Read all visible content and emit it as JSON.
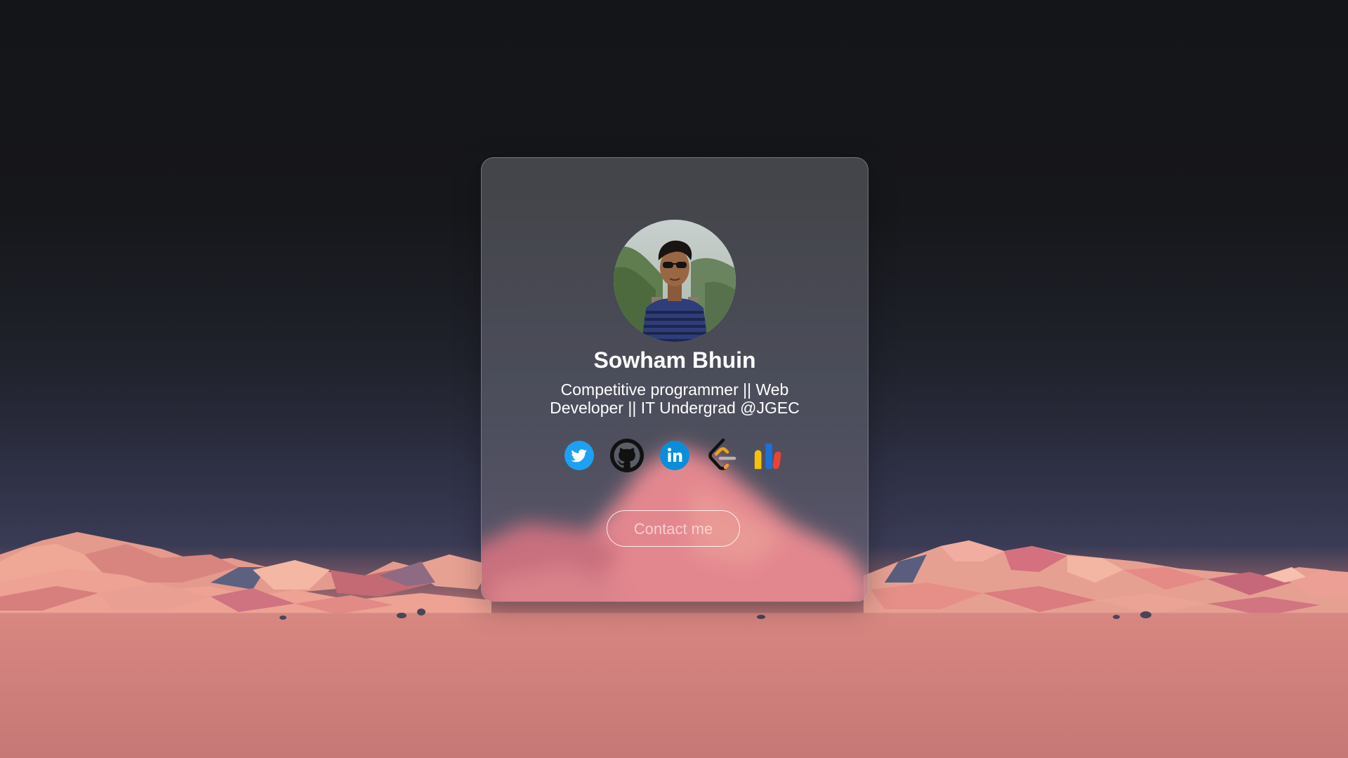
{
  "profile": {
    "name": "Sowham Bhuin",
    "bio": "Competitive programmer || Web Developer || IT Undergrad @JGEC",
    "avatar_alt": "profile photo"
  },
  "socials": [
    {
      "name": "twitter",
      "icon": "twitter-icon",
      "color": "#1da1f2"
    },
    {
      "name": "github",
      "icon": "github-icon",
      "color": "#111111"
    },
    {
      "name": "linkedin",
      "icon": "linkedin-icon",
      "color": "#0a8ed9"
    },
    {
      "name": "leetcode",
      "icon": "leetcode-icon",
      "color": "#f0a020"
    },
    {
      "name": "google-analytics",
      "icon": "bar-chart-icon",
      "color": "#1e6fd6"
    }
  ],
  "contact": {
    "label": "Contact me"
  },
  "colors": {
    "sky_top": "#141518",
    "mountain": "#e8908a",
    "ground": "#c57876",
    "card_border": "#ffffff"
  }
}
